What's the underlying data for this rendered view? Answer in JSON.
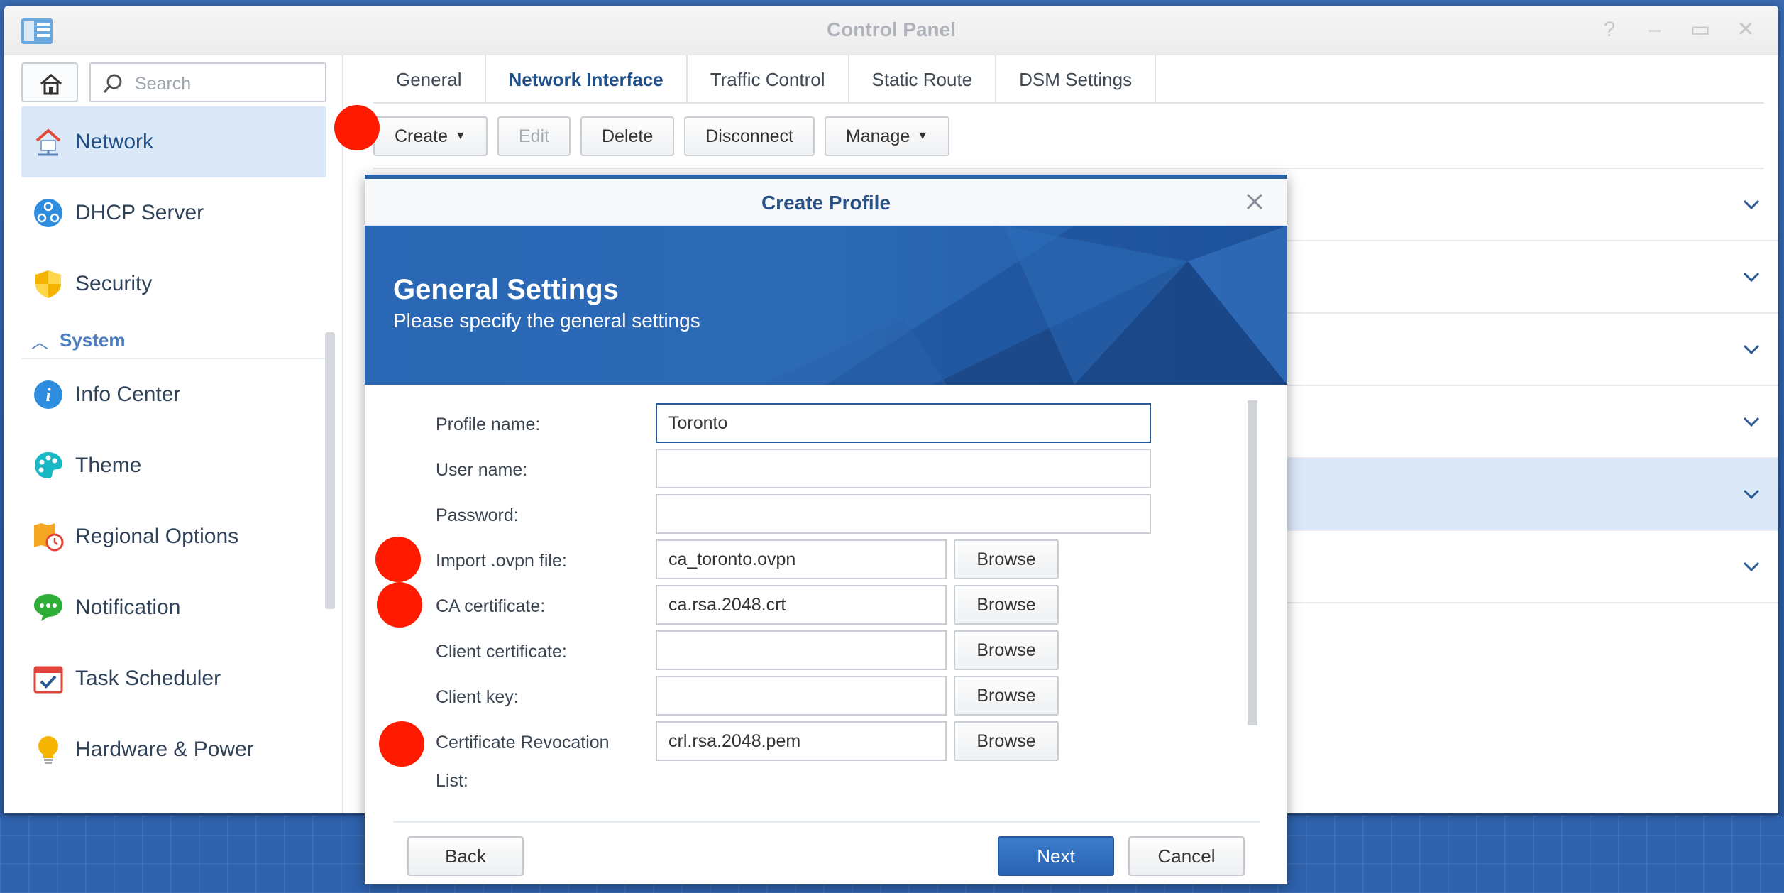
{
  "window": {
    "title": "Control Panel"
  },
  "sidebar": {
    "search_placeholder": "Search",
    "items": [
      {
        "label": "Network",
        "icon": "network-icon",
        "active": true
      },
      {
        "label": "DHCP Server",
        "icon": "dhcp-icon"
      },
      {
        "label": "Security",
        "icon": "shield-icon"
      }
    ],
    "group": {
      "label": "System",
      "icon": "chevron-up-icon"
    },
    "system_items": [
      {
        "label": "Info Center",
        "icon": "info-icon"
      },
      {
        "label": "Theme",
        "icon": "palette-icon"
      },
      {
        "label": "Regional Options",
        "icon": "regional-icon"
      },
      {
        "label": "Notification",
        "icon": "chat-bubble-icon"
      },
      {
        "label": "Task Scheduler",
        "icon": "calendar-check-icon"
      },
      {
        "label": "Hardware & Power",
        "icon": "bulb-icon"
      }
    ]
  },
  "tabs": [
    "General",
    "Network Interface",
    "Traffic Control",
    "Static Route",
    "DSM Settings"
  ],
  "selected_tab": "Network Interface",
  "toolbar": {
    "create": "Create",
    "edit": "Edit",
    "delete": "Delete",
    "disconnect": "Disconnect",
    "manage": "Manage"
  },
  "dialog": {
    "title": "Create Profile",
    "banner_title": "General Settings",
    "banner_subtitle": "Please specify the general settings",
    "fields": {
      "profile_name": {
        "label": "Profile name:",
        "value": "Toronto"
      },
      "user_name": {
        "label": "User name:",
        "value": ""
      },
      "password": {
        "label": "Password:",
        "value": ""
      },
      "import_ovpn": {
        "label": "Import .ovpn file:",
        "value": "ca_toronto.ovpn"
      },
      "ca_cert": {
        "label": "CA certificate:",
        "value": "ca.rsa.2048.crt"
      },
      "client_cert": {
        "label": "Client certificate:",
        "value": ""
      },
      "client_key": {
        "label": "Client key:",
        "value": ""
      },
      "crl": {
        "label_line1": "Certificate Revocation",
        "label_line2": "List:",
        "value": "crl.rsa.2048.pem"
      }
    },
    "browse": "Browse",
    "back": "Back",
    "next": "Next",
    "cancel": "Cancel"
  },
  "colors": {
    "accent": "#2a62a8",
    "marker": "#ff1a00",
    "selection": "#dbe8f8"
  }
}
